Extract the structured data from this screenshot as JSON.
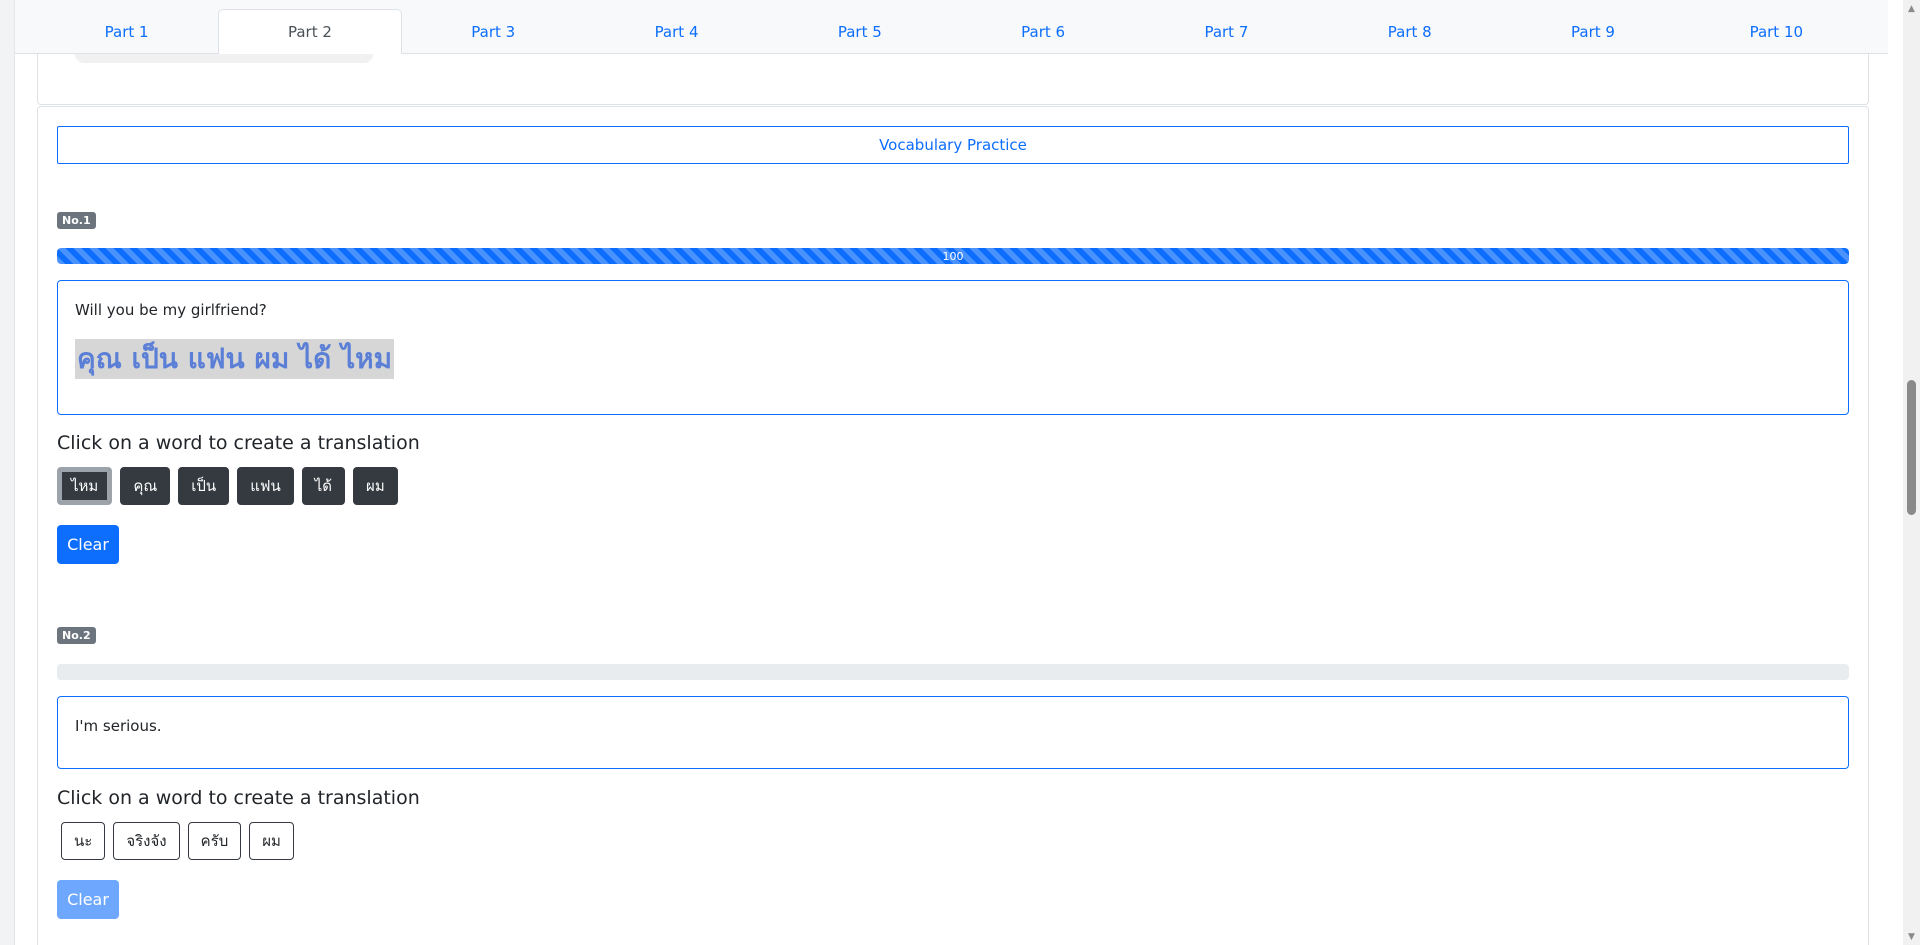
{
  "tabs": [
    "Part 1",
    "Part 2",
    "Part 3",
    "Part 4",
    "Part 5",
    "Part 6",
    "Part 7",
    "Part 8",
    "Part 9",
    "Part 10"
  ],
  "active_tab": "Part 2",
  "vocab_button": "Vocabulary Practice",
  "questions": [
    {
      "number": "No.1",
      "progress_label": "100",
      "progress_fraction": 1.0,
      "english": "Will you be my girlfriend?",
      "answer": "คุณ เป็น แฟน ผม ได้ ไหม",
      "instruction": "Click on a word to create a translation",
      "words": [
        "ไหม",
        "คุณ",
        "เป็น",
        "แฟน",
        "ได้",
        "ผม"
      ],
      "clear": "Clear"
    },
    {
      "number": "No.2",
      "progress_label": "",
      "progress_fraction": 0.0,
      "english": "I'm serious.",
      "answer": "",
      "instruction": "Click on a word to create a translation",
      "words": [
        "นะ",
        "จริงจัง",
        "ครับ",
        "ผม"
      ],
      "clear": "Clear"
    }
  ],
  "colors": {
    "accent": "#0d6efd",
    "dark_button": "#343a40",
    "badge": "#6c757d",
    "answer_highlight": "#d6d6d6",
    "answer_text": "#5b7fd6"
  },
  "icons": {
    "scroll_up": "scroll-up-arrow-icon",
    "scroll_down": "scroll-down-arrow-icon"
  }
}
